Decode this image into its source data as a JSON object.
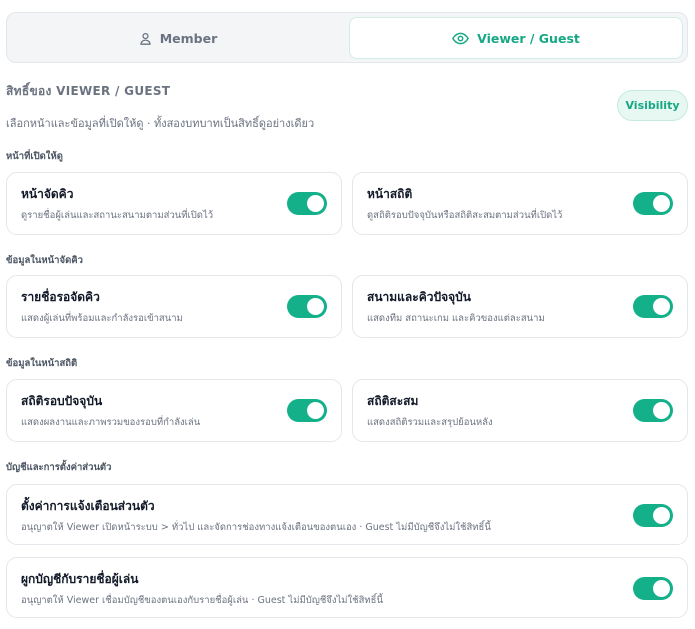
{
  "tabs": [
    {
      "label": "Member",
      "icon": "user-icon",
      "active": false
    },
    {
      "label": "Viewer / Guest",
      "icon": "eye-icon",
      "active": true
    }
  ],
  "colors": {
    "accent": "#14b08a",
    "accent_text": "#16a885",
    "muted": "#6b7280"
  },
  "section": {
    "title": "สิทธิ์ของ VIEWER / GUEST",
    "description": "เลือกหน้าและข้อมูลที่เปิดให้ดู · ทั้งสองบทบาทเป็นสิทธิ์ดูอย่างเดียว",
    "badge": "Visibility"
  },
  "groups": {
    "pages": {
      "heading": "หน้าที่เปิดให้ดู",
      "items": [
        {
          "title": "หน้าจัดคิว",
          "desc": "ดูรายชื่อผู้เล่นและสถานะสนามตามส่วนที่เปิดไว้",
          "enabled": true
        },
        {
          "title": "หน้าสถิติ",
          "desc": "ดูสถิติรอบปัจจุบันหรือสถิติสะสมตามส่วนที่เปิดไว้",
          "enabled": true
        }
      ]
    },
    "queue_data": {
      "heading": "ข้อมูลในหน้าจัดคิว",
      "items": [
        {
          "title": "รายชื่อรอจัดคิว",
          "desc": "แสดงผู้เล่นที่พร้อมและกำลังรอเข้าสนาม",
          "enabled": true
        },
        {
          "title": "สนามและคิวปัจจุบัน",
          "desc": "แสดงทีม สถานะเกม และคิวของแต่ละสนาม",
          "enabled": true
        }
      ]
    },
    "stats_data": {
      "heading": "ข้อมูลในหน้าสถิติ",
      "items": [
        {
          "title": "สถิติรอบปัจจุบัน",
          "desc": "แสดงผลงานและภาพรวมของรอบที่กำลังเล่น",
          "enabled": true
        },
        {
          "title": "สถิติสะสม",
          "desc": "แสดงสถิติรวมและสรุปย้อนหลัง",
          "enabled": true
        }
      ]
    },
    "account": {
      "heading": "บัญชีและการตั้งค่าส่วนตัว",
      "items": [
        {
          "title": "ตั้งค่าการแจ้งเตือนส่วนตัว",
          "desc": "อนุญาตให้ Viewer เปิดหน้าระบบ > ทั่วไป และจัดการช่องทางแจ้งเตือนของตนเอง · Guest ไม่มีบัญชีจึงไม่ใช้สิทธิ์นี้",
          "enabled": true
        },
        {
          "title": "ผูกบัญชีกับรายชื่อผู้เล่น",
          "desc": "อนุญาตให้ Viewer เชื่อมบัญชีของตนเองกับรายชื่อผู้เล่น · Guest ไม่มีบัญชีจึงไม่ใช้สิทธิ์นี้",
          "enabled": true
        }
      ]
    }
  }
}
